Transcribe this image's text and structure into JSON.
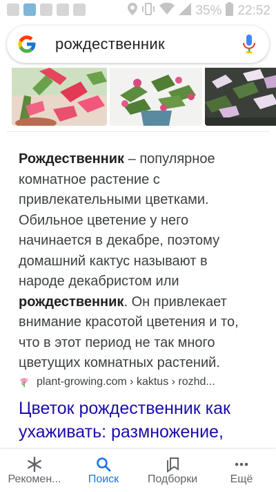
{
  "status_bar": {
    "battery": "35%",
    "time": "22:52"
  },
  "search": {
    "query": "рождественник",
    "logo_icon": "google-g-icon",
    "mic_icon": "microphone-icon"
  },
  "images": [
    {
      "name": "schlumbergera-red-photo"
    },
    {
      "name": "schlumbergera-pot-photo"
    },
    {
      "name": "schlumbergera-white-photo"
    }
  ],
  "snippet": {
    "part1_bold": "Рождественник",
    "part2": " – популярное комнатное растение с привлекательными цветками. Обильное цветение у него начинается в декабре, поэтому домашний кактус называют в народе декабристом или ",
    "part3_bold": "рождественник",
    "part4": ". Он привлекает внимание красотой цветения и то, что в этот период не так много цветущих комнатных растений."
  },
  "source": {
    "breadcrumb": "plant-growing.com › kaktus › rozhd..."
  },
  "result": {
    "title": "Цветок рождественник как ухаживать: размножение,"
  },
  "bottom_nav": {
    "items": [
      {
        "label": "Рекомен...",
        "icon": "asterisk-icon",
        "active": false
      },
      {
        "label": "Поиск",
        "icon": "search-icon",
        "active": true
      },
      {
        "label": "Подборки",
        "icon": "collections-icon",
        "active": false
      },
      {
        "label": "Ещё",
        "icon": "more-dots-icon",
        "active": false
      }
    ]
  },
  "colors": {
    "link": "#1a0dab",
    "active_nav": "#1a73e8",
    "text": "#3c4043"
  }
}
